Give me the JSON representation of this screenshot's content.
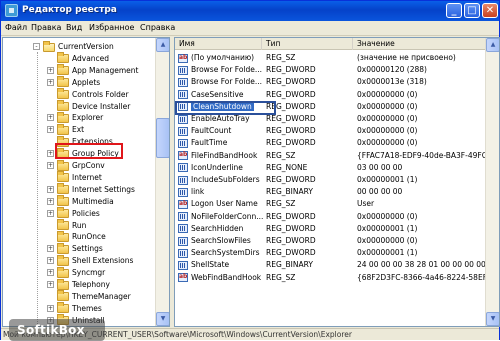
{
  "window": {
    "title": "Редактор реестра",
    "minimize": "_",
    "maximize": "□",
    "close": "✕"
  },
  "menu": [
    "Файл",
    "Правка",
    "Вид",
    "Избранное",
    "Справка"
  ],
  "tree": {
    "items": [
      {
        "label": "CurrentVersion",
        "expander": "-"
      },
      {
        "label": "Advanced",
        "expander": ""
      },
      {
        "label": "App Management",
        "expander": "+"
      },
      {
        "label": "Applets",
        "expander": "+"
      },
      {
        "label": "Controls Folder",
        "expander": ""
      },
      {
        "label": "Device Installer",
        "expander": ""
      },
      {
        "label": "Explorer",
        "expander": "+"
      },
      {
        "label": "Ext",
        "expander": "+"
      },
      {
        "label": "Extensions",
        "expander": ""
      },
      {
        "label": "Group Policy",
        "expander": "+"
      },
      {
        "label": "GrpConv",
        "expander": "+"
      },
      {
        "label": "Internet",
        "expander": ""
      },
      {
        "label": "Internet Settings",
        "expander": "+"
      },
      {
        "label": "Multimedia",
        "expander": "+"
      },
      {
        "label": "Policies",
        "expander": "+"
      },
      {
        "label": "Run",
        "expander": ""
      },
      {
        "label": "RunOnce",
        "expander": ""
      },
      {
        "label": "Settings",
        "expander": "+"
      },
      {
        "label": "Shell Extensions",
        "expander": "+"
      },
      {
        "label": "Syncmgr",
        "expander": "+"
      },
      {
        "label": "Telephony",
        "expander": "+"
      },
      {
        "label": "ThemeManager",
        "expander": ""
      },
      {
        "label": "Themes",
        "expander": "+"
      },
      {
        "label": "Uninstall",
        "expander": "+"
      }
    ]
  },
  "list": {
    "columns": [
      "Имя",
      "Тип",
      "Значение"
    ],
    "rows": [
      {
        "icon": "string-value-icon",
        "name": "(По умолчанию)",
        "type": "REG_SZ",
        "value": "(значение не присвоено)"
      },
      {
        "icon": "dword-value-icon",
        "name": "Browse For Folde...",
        "type": "REG_DWORD",
        "value": "0x00000120 (288)"
      },
      {
        "icon": "dword-value-icon",
        "name": "Browse For Folde...",
        "type": "REG_DWORD",
        "value": "0x0000013e (318)"
      },
      {
        "icon": "dword-value-icon",
        "name": "CaseSensitive",
        "type": "REG_DWORD",
        "value": "0x00000000 (0)"
      },
      {
        "icon": "dword-value-icon",
        "name": "CleanShutdown",
        "type": "REG_DWORD",
        "value": "0x00000000 (0)"
      },
      {
        "icon": "dword-value-icon",
        "name": "EnableAutoTray",
        "type": "REG_DWORD",
        "value": "0x00000000 (0)"
      },
      {
        "icon": "dword-value-icon",
        "name": "FaultCount",
        "type": "REG_DWORD",
        "value": "0x00000000 (0)"
      },
      {
        "icon": "dword-value-icon",
        "name": "FaultTime",
        "type": "REG_DWORD",
        "value": "0x00000000 (0)"
      },
      {
        "icon": "string-value-icon",
        "name": "FileFindBandHook",
        "type": "REG_SZ",
        "value": "{FFAC7A18-EDF9-40de-BA3F-49FC22698"
      },
      {
        "icon": "binary-value-icon",
        "name": "IconUnderline",
        "type": "REG_NONE",
        "value": "03 00 00 00"
      },
      {
        "icon": "dword-value-icon",
        "name": "IncludeSubFolders",
        "type": "REG_DWORD",
        "value": "0x00000001 (1)"
      },
      {
        "icon": "binary-value-icon",
        "name": "link",
        "type": "REG_BINARY",
        "value": "00 00 00 00"
      },
      {
        "icon": "string-value-icon",
        "name": "Logon User Name",
        "type": "REG_SZ",
        "value": "User"
      },
      {
        "icon": "dword-value-icon",
        "name": "NoFileFolderConn...",
        "type": "REG_DWORD",
        "value": "0x00000000 (0)"
      },
      {
        "icon": "dword-value-icon",
        "name": "SearchHidden",
        "type": "REG_DWORD",
        "value": "0x00000001 (1)"
      },
      {
        "icon": "dword-value-icon",
        "name": "SearchSlowFiles",
        "type": "REG_DWORD",
        "value": "0x00000000 (0)"
      },
      {
        "icon": "dword-value-icon",
        "name": "SearchSystemDirs",
        "type": "REG_DWORD",
        "value": "0x00000001 (1)"
      },
      {
        "icon": "binary-value-icon",
        "name": "ShellState",
        "type": "REG_BINARY",
        "value": "24 00 00 00 38 28 01 00 00 00 00 00 00 00"
      },
      {
        "icon": "string-value-icon",
        "name": "WebFindBandHook",
        "type": "REG_SZ",
        "value": "{68F2D3FC-8366-4a46-8224-58EFA2749"
      }
    ]
  },
  "status": {
    "path": "Мой компьютер\\HKEY_CURRENT_USER\\Software\\Microsoft\\Windows\\CurrentVersion\\Explorer"
  },
  "watermark": "SoftikBox",
  "colors": {
    "title_bar": "#0542c9",
    "highlight_red": "#e0161b",
    "selection_blue": "#316ac5"
  }
}
